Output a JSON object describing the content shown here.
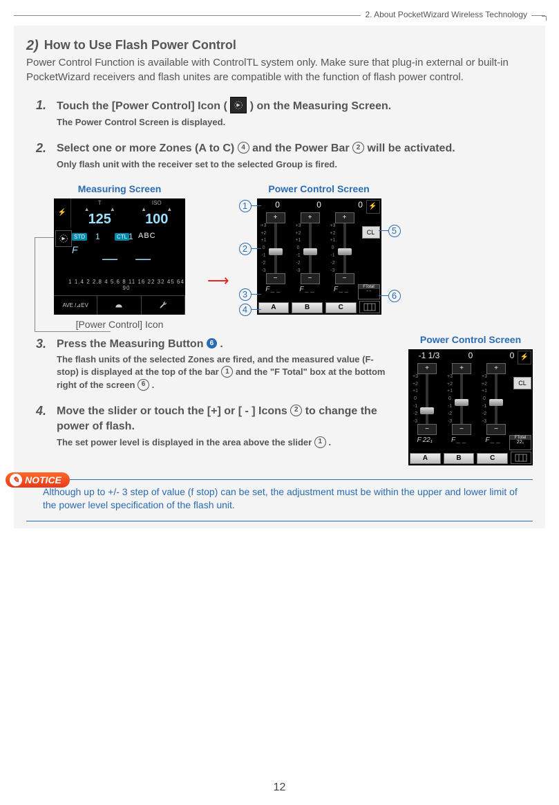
{
  "header": {
    "chapter": "2.  About PocketWizard Wireless Technology"
  },
  "section": {
    "number_label": "2)",
    "title": "How to Use Flash Power Control",
    "intro": "Power Control Function is available with ControlTL system only. Make sure that plug-in external or built-in PocketWizard receivers and flash unites are compatible with the function of flash power control."
  },
  "steps": {
    "s1": {
      "num": "1.",
      "title_a": "Touch the [Power Control] Icon ( ",
      "title_b": " ) on the Measuring Screen.",
      "sub": "The Power Control Screen is displayed."
    },
    "s2": {
      "num": "2.",
      "title_a": "Select one or more Zones (A to C) ",
      "ref4": "4",
      "title_b": " and the Power Bar ",
      "ref2": "2",
      "title_c": " will be activated.",
      "sub": "Only flash unit with the receiver set to the selected Group is fired."
    },
    "s3": {
      "num": "3.",
      "title_a": "Press the Measuring Button ",
      "ref6": "6",
      "title_b": ".",
      "sub_a": "The flash units of the selected Zones are fired, and the measured value (F-stop) is displayed at the top of the bar ",
      "ref1": "1",
      "sub_b": " and the \"F Total\" box at the bottom right of the screen ",
      "ref6b": "6",
      "sub_c": "."
    },
    "s4": {
      "num": "4.",
      "title_a": "Move the slider or touch the [+] or [ - ] Icons ",
      "ref2": "2",
      "title_b": " to change the power of flash.",
      "sub_a": "The set power level is displayed in the area above the slider ",
      "ref1": "1",
      "sub_b": "."
    }
  },
  "captions": {
    "measuring": "Measuring Screen",
    "power_control": "Power Control Screen",
    "pc_icon": "[Power Control] Icon"
  },
  "measuring_screen": {
    "t_label": "T",
    "t_value": "125",
    "iso_label": "ISO",
    "iso_value": "100",
    "std": "STD",
    "ctl": "CTL",
    "one_a": "1",
    "one_b": "1",
    "abc": "ABC",
    "F": "F",
    "dashes": "— —",
    "scale": "1 1.4 2  2.8  4 5.6  8  11 16 22 32 45 64 90",
    "ave": "AVE /",
    "ev": "⊿EV"
  },
  "pc_screen": {
    "vals": [
      "0",
      "0",
      "0"
    ],
    "cl": "CL",
    "f_dashes": "_ _",
    "ftotal_label": "FTotal",
    "ftotal_val": "- -",
    "zones": [
      "A",
      "B",
      "C"
    ],
    "ticks": [
      "+3",
      "+2",
      "+1",
      "0",
      "-1",
      "-2",
      "-3"
    ]
  },
  "pc_screen2": {
    "vals": [
      "-1 1/3",
      "0",
      "0"
    ],
    "cl": "CL",
    "f_vals": [
      "22₁",
      "_ _",
      "_ _"
    ],
    "ftotal_label": "FTotal",
    "ftotal_val": "22₁",
    "zones": [
      "A",
      "B",
      "C"
    ]
  },
  "callouts": {
    "c1": "1",
    "c2": "2",
    "c3": "3",
    "c4": "4",
    "c5": "5",
    "c6": "6"
  },
  "notice": {
    "badge": "NOTICE",
    "text": "Although up to +/- 3 step of value (f stop) can be set, the adjustment must be within the upper and lower limit of the power level specification of the flash unit."
  },
  "page_number": "12"
}
